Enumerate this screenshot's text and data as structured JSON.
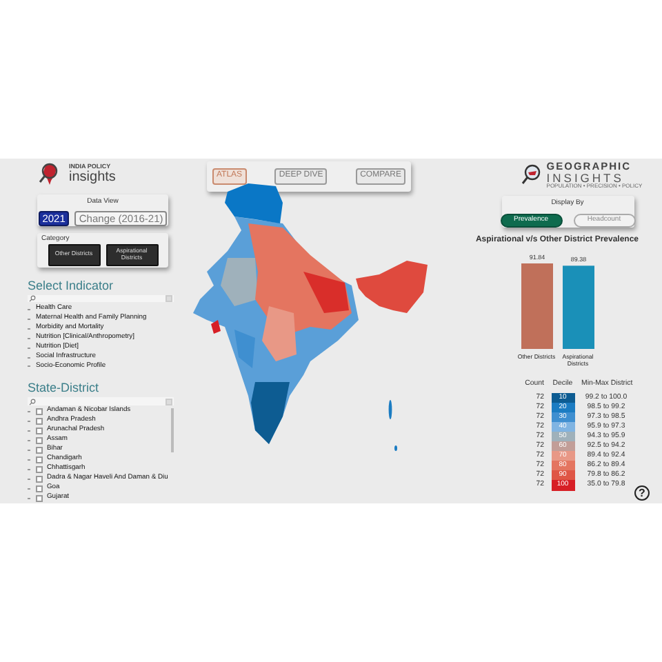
{
  "header": {
    "left_logo": {
      "line1": "INDIA POLICY",
      "line2": "insights"
    },
    "nav": [
      {
        "label": "ATLAS",
        "selected": true
      },
      {
        "label": "DEEP DIVE",
        "selected": false
      },
      {
        "label": "COMPARE",
        "selected": false
      }
    ],
    "right_logo": {
      "line1": "GEOGRAPHIC",
      "line2": "INSIGHTS",
      "tagline": "POPULATION • PRECISION • POLICY"
    }
  },
  "data_view": {
    "title": "Data View",
    "options": [
      {
        "label": "2021",
        "selected": true
      },
      {
        "label": "Change (2016-21)",
        "selected": false
      }
    ]
  },
  "category": {
    "title": "Category",
    "options": [
      {
        "label": "Other Districts"
      },
      {
        "label": "Aspirational Districts"
      }
    ]
  },
  "indicators": {
    "title": "Select Indicator",
    "items": [
      {
        "label": "Health Care"
      },
      {
        "label": "Maternal Health and Family Planning"
      },
      {
        "label": "Morbidity and Mortality"
      },
      {
        "label": "Nutrition [Clinical/Anthropometry]"
      },
      {
        "label": "Nutrition [Diet]"
      },
      {
        "label": "Social Infrastructure"
      },
      {
        "label": "Socio-Economic Profile"
      }
    ]
  },
  "state_district": {
    "title": "State-District",
    "items": [
      {
        "label": "Andaman & Nicobar Islands",
        "checked": false
      },
      {
        "label": "Andhra Pradesh",
        "checked": false
      },
      {
        "label": "Arunachal Pradesh",
        "checked": false
      },
      {
        "label": "Assam",
        "checked": false
      },
      {
        "label": "Bihar",
        "checked": false
      },
      {
        "label": "Chandigarh",
        "checked": false
      },
      {
        "label": "Chhattisgarh",
        "checked": false
      },
      {
        "label": "Dadra & Nagar Haveli And Daman & Diu",
        "checked": false
      },
      {
        "label": "Goa",
        "checked": false
      },
      {
        "label": "Gujarat",
        "checked": false
      }
    ]
  },
  "display_by": {
    "title": "Display By",
    "options": [
      {
        "label": "Prevalence",
        "selected": true
      },
      {
        "label": "Headcount",
        "selected": false
      }
    ]
  },
  "chart": {
    "chart_data": {
      "type": "bar",
      "title": "Aspirational v/s Other District Prevalence",
      "data_labels": true,
      "series": [
        {
          "name": "Other Districts",
          "color": "#c0705a",
          "values": [
            91.84
          ]
        },
        {
          "name": "Aspirational Districts",
          "color": "#1a90b8",
          "values": [
            89.38
          ]
        }
      ]
    }
  },
  "legend": {
    "columns": [
      "Count",
      "Decile",
      "Min-Max District"
    ],
    "rows": [
      {
        "count": "72",
        "decile": "10",
        "color": "#0d5c92",
        "range": "99.2 to 100.0"
      },
      {
        "count": "72",
        "decile": "20",
        "color": "#1b7cc2",
        "range": "98.5 to 99.2"
      },
      {
        "count": "72",
        "decile": "30",
        "color": "#3f8fd0",
        "range": "97.3 to 98.5"
      },
      {
        "count": "72",
        "decile": "40",
        "color": "#80b4e2",
        "range": "95.9 to 97.3"
      },
      {
        "count": "72",
        "decile": "50",
        "color": "#9fb1bb",
        "range": "94.3 to 95.9"
      },
      {
        "count": "72",
        "decile": "60",
        "color": "#c29e98",
        "range": "92.5 to 94.2"
      },
      {
        "count": "72",
        "decile": "70",
        "color": "#e89886",
        "range": "89.4 to 92.4"
      },
      {
        "count": "72",
        "decile": "80",
        "color": "#e47560",
        "range": "86.2 to 89.4"
      },
      {
        "count": "72",
        "decile": "90",
        "color": "#df5646",
        "range": "79.8 to 86.2"
      },
      {
        "count": "72",
        "decile": "100",
        "color": "#d71f26",
        "range": "35.0 to 79.8"
      }
    ]
  },
  "help": {
    "label": "?"
  }
}
